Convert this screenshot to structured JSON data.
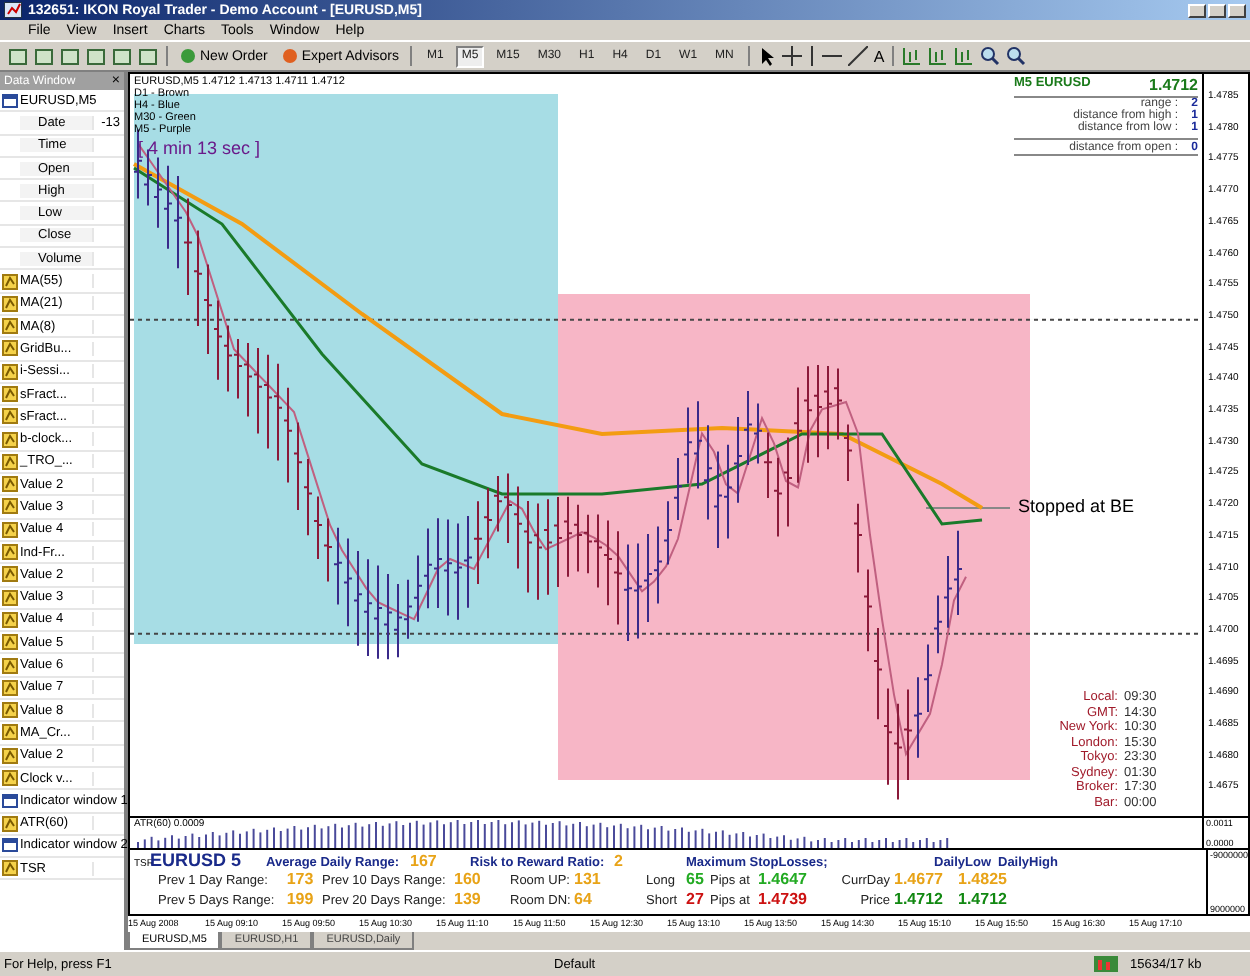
{
  "window": {
    "title": "132651: IKON Royal Trader - Demo Account - [EURUSD,M5]"
  },
  "menu": [
    "File",
    "View",
    "Insert",
    "Charts",
    "Tools",
    "Window",
    "Help"
  ],
  "toolbar": {
    "buttons": [
      "New Order",
      "Expert Advisors"
    ],
    "timeframes": [
      {
        "label": "M1",
        "selected": false
      },
      {
        "label": "M5",
        "selected": true
      },
      {
        "label": "M15",
        "selected": false
      },
      {
        "label": "M30",
        "selected": false
      },
      {
        "label": "H1",
        "selected": false
      },
      {
        "label": "H4",
        "selected": false
      },
      {
        "label": "D1",
        "selected": false
      },
      {
        "label": "W1",
        "selected": false
      },
      {
        "label": "MN",
        "selected": false
      }
    ],
    "text_tool": "A"
  },
  "data_window": {
    "title": "Data Window",
    "close": "×",
    "rows": [
      {
        "kind": "window",
        "label": "EURUSD,M5"
      },
      {
        "kind": "field",
        "label": "Date",
        "value": "-13"
      },
      {
        "kind": "field",
        "label": "Time"
      },
      {
        "kind": "field",
        "label": "Open"
      },
      {
        "kind": "field",
        "label": "High"
      },
      {
        "kind": "field",
        "label": "Low"
      },
      {
        "kind": "field",
        "label": "Close"
      },
      {
        "kind": "field",
        "label": "Volume"
      },
      {
        "kind": "indicator",
        "label": "MA(55)"
      },
      {
        "kind": "indicator",
        "label": "MA(21)"
      },
      {
        "kind": "indicator",
        "label": "MA(8)"
      },
      {
        "kind": "indicator",
        "label": "GridBu..."
      },
      {
        "kind": "indicator",
        "label": "i-Sessi..."
      },
      {
        "kind": "indicator",
        "label": "sFract..."
      },
      {
        "kind": "indicator",
        "label": "sFract..."
      },
      {
        "kind": "indicator",
        "label": "b-clock..."
      },
      {
        "kind": "indicator",
        "label": "_TRO_..."
      },
      {
        "kind": "indicator",
        "label": "Value 2"
      },
      {
        "kind": "indicator",
        "label": "Value 3"
      },
      {
        "kind": "indicator",
        "label": "Value 4"
      },
      {
        "kind": "indicator",
        "label": "Ind-Fr..."
      },
      {
        "kind": "indicator",
        "label": "Value 2"
      },
      {
        "kind": "indicator",
        "label": "Value 3"
      },
      {
        "kind": "indicator",
        "label": "Value 4"
      },
      {
        "kind": "indicator",
        "label": "Value 5"
      },
      {
        "kind": "indicator",
        "label": "Value 6"
      },
      {
        "kind": "indicator",
        "label": "Value 7"
      },
      {
        "kind": "indicator",
        "label": "Value 8"
      },
      {
        "kind": "indicator",
        "label": "MA_Cr..."
      },
      {
        "kind": "indicator",
        "label": "Value 2"
      },
      {
        "kind": "indicator",
        "label": "Clock v..."
      },
      {
        "kind": "window",
        "label": "Indicator window 1"
      },
      {
        "kind": "indicator",
        "label": "ATR(60)"
      },
      {
        "kind": "window",
        "label": "Indicator window 2"
      },
      {
        "kind": "indicator",
        "label": "TSR"
      }
    ]
  },
  "chart": {
    "header": "EURUSD,M5  1.4712 1.4713 1.4711 1.4712",
    "legend": [
      "D1 - Brown",
      "H4 - Blue",
      "M30 - Green",
      "M5 - Purple"
    ],
    "timer": "[ 4 min 13 sec ]",
    "info": {
      "symbol": "M5 EURUSD",
      "price": "1.4712",
      "rows": [
        {
          "label": "range :",
          "value": "2"
        },
        {
          "label": "distance from high :",
          "value": "1"
        },
        {
          "label": "distance from low :",
          "value": "1"
        }
      ],
      "open_row": {
        "label": "distance from open :",
        "value": "0"
      }
    },
    "annotation": "Stopped at BE",
    "clocks": [
      {
        "label": "Local:",
        "time": "09:30"
      },
      {
        "label": "GMT:",
        "time": "14:30"
      },
      {
        "label": "New York:",
        "time": "10:30"
      },
      {
        "label": "London:",
        "time": "15:30"
      },
      {
        "label": "Tokyo:",
        "time": "23:30"
      },
      {
        "label": "Sydney:",
        "time": "01:30"
      },
      {
        "label": "Broker:",
        "time": "17:30"
      },
      {
        "label": "Bar:",
        "time": "00:00"
      }
    ],
    "price_axis": [
      "1.4785",
      "1.4780",
      "1.4775",
      "1.4770",
      "1.4765",
      "1.4760",
      "1.4755",
      "1.4750",
      "1.4745",
      "1.4740",
      "1.4735",
      "1.4730",
      "1.4725",
      "1.4720",
      "1.4715",
      "1.4710",
      "1.4705",
      "1.4700",
      "1.4695",
      "1.4690",
      "1.4685",
      "1.4680",
      "1.4675"
    ]
  },
  "atr": {
    "label": "ATR(60) 0.0009",
    "axis": [
      "0.0011",
      "0.0000"
    ]
  },
  "tsr": {
    "label": "TSR",
    "title": "EURUSD 5",
    "avg_label": "Average Daily Range:",
    "avg": "167",
    "rr_label": "Risk to Reward Ratio:",
    "rr": "2",
    "sl_title": "Maximum StopLosses;",
    "low_head": "DailyLow",
    "high_head": "DailyHigh",
    "axis": [
      "-9000000",
      "9000000"
    ],
    "rows": [
      {
        "a_label": "Prev 1 Day Range:",
        "a": "173",
        "b_label": "Prev 10 Days Range:",
        "b": "160",
        "room_label": "Room UP:",
        "room": "131",
        "sl_label": "Long",
        "sl": "65",
        "at_label": "Pips at",
        "at": "1.4647",
        "day_label": "CurrDay",
        "low": "1.4677",
        "high": "1.4825",
        "kind": "long"
      },
      {
        "a_label": "Prev 5 Days Range:",
        "a": "199",
        "b_label": "Prev 20 Days Range:",
        "b": "139",
        "room_label": "Room DN:",
        "room": "64",
        "sl_label": "Short",
        "sl": "27",
        "at_label": "Pips at",
        "at": "1.4739",
        "day_label": "Price",
        "low": "1.4712",
        "high": "1.4712",
        "kind": "short"
      }
    ]
  },
  "time_axis": [
    "15 Aug 2008",
    "15 Aug 09:10",
    "15 Aug 09:50",
    "15 Aug 10:30",
    "15 Aug 11:10",
    "15 Aug 11:50",
    "15 Aug 12:30",
    "15 Aug 13:10",
    "15 Aug 13:50",
    "15 Aug 14:30",
    "15 Aug 15:10",
    "15 Aug 15:50",
    "15 Aug 16:30",
    "15 Aug 17:10"
  ],
  "tabs": [
    {
      "label": "EURUSD,M5",
      "selected": true
    },
    {
      "label": "EURUSD,H1",
      "selected": false
    },
    {
      "label": "EURUSD,Daily",
      "selected": false
    }
  ],
  "status_bar": {
    "help": "For Help, press F1",
    "profile": "Default",
    "traffic": "15634/17 kb"
  }
}
